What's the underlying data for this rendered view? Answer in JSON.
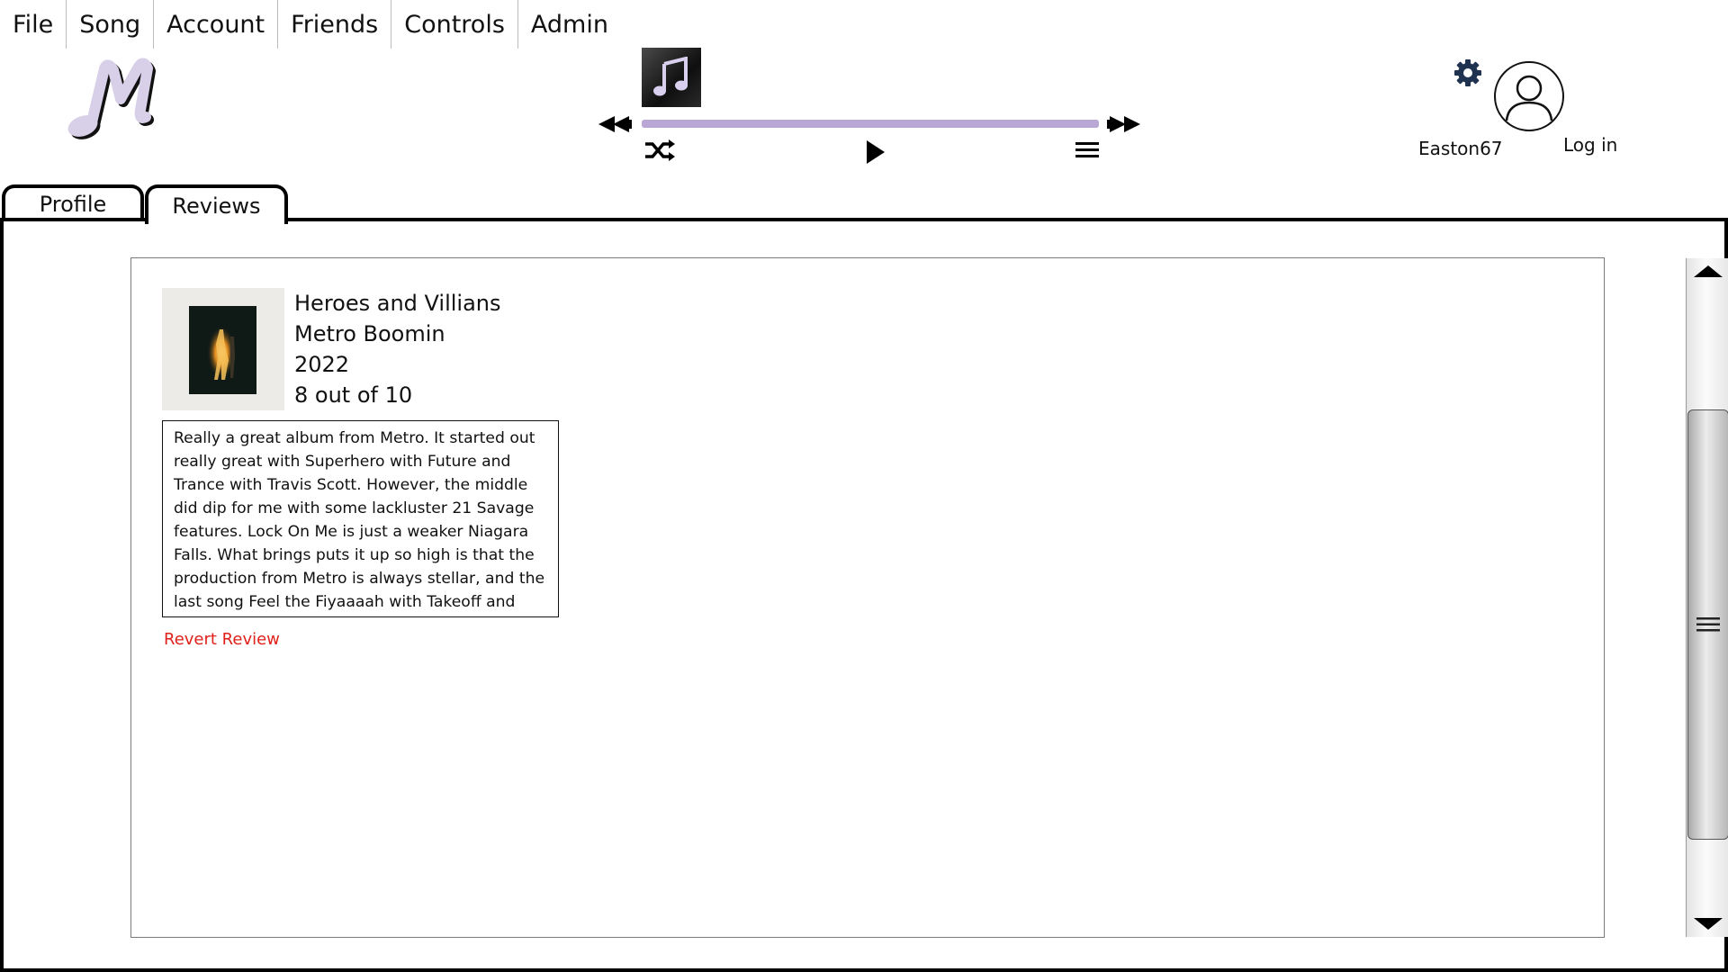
{
  "menu": {
    "items": [
      {
        "label": "File"
      },
      {
        "label": "Song"
      },
      {
        "label": "Account"
      },
      {
        "label": "Friends"
      },
      {
        "label": "Controls"
      },
      {
        "label": "Admin"
      }
    ]
  },
  "logo": {
    "glyph": "M",
    "color": "#d8d0e8"
  },
  "player": {
    "progress_percent": 100,
    "track_color": "#d8cfe6",
    "icons": [
      "music-note-icon",
      "rewind-icon",
      "fast-forward-icon",
      "shuffle-icon",
      "play-icon",
      "queue-list-icon"
    ]
  },
  "user": {
    "username": "Easton67",
    "login_label": "Log in",
    "icons": [
      "gear-icon",
      "user-avatar-icon"
    ]
  },
  "tabs": [
    {
      "label": "Profile",
      "active": false
    },
    {
      "label": "Reviews",
      "active": true
    }
  ],
  "review": {
    "album": "Heroes and Villians",
    "artist": "Metro Boomin",
    "year": "2022",
    "rating": "8 out of 10",
    "text": "Really a great album from Metro. It started out really great with Superhero with Future and Trance with Travis Scott. However, the middle did dip for me with some lackluster 21 Savage features. Lock On Me is just a weaker Niagara Falls. What brings puts it up so high is that the production from Metro is always stellar, and the last song Feel the Fiyaaaah with Takeoff and",
    "revert_label": "Revert Review",
    "revert_color": "#e0201a"
  },
  "scrollbar": {
    "icons": [
      "scroll-up-arrow-icon",
      "scroll-grip-icon",
      "scroll-down-arrow-icon"
    ]
  }
}
